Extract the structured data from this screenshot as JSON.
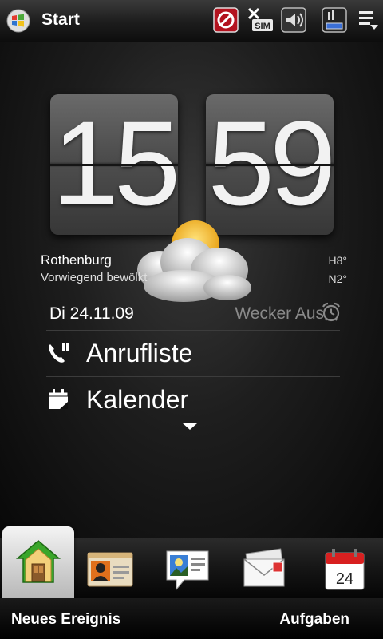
{
  "status_bar": {
    "title": "Start",
    "icons": [
      "windows-start-icon",
      "no-signal-icon",
      "no-sim-icon",
      "speaker-icon",
      "battery-icon",
      "menu-icon"
    ],
    "sim_label": "SIM"
  },
  "clock": {
    "hours": "15",
    "minutes": "59"
  },
  "weather": {
    "city": "Rothenburg",
    "condition": "Vorwiegend bewölkt",
    "high": "H8°",
    "low": "N2°",
    "icon": "partly-cloudy-icon"
  },
  "date": "Di 24.11.09",
  "alarm": "Wecker Aus",
  "menu": [
    {
      "label": "Anrufliste",
      "icon": "call-history-icon"
    },
    {
      "label": "Kalender",
      "icon": "calendar-icon"
    }
  ],
  "dock": {
    "tabs": [
      "home-icon",
      "contacts-icon",
      "photos-icon",
      "messages-icon",
      "calendar-icon"
    ],
    "calendar_day": "24"
  },
  "softkeys": {
    "left": "Neues Ereignis",
    "right": "Aufgaben"
  },
  "colors": {
    "alarm_gray": "#8a8a8a",
    "home_green": "#3aa62a",
    "stop_red": "#b3131f"
  }
}
